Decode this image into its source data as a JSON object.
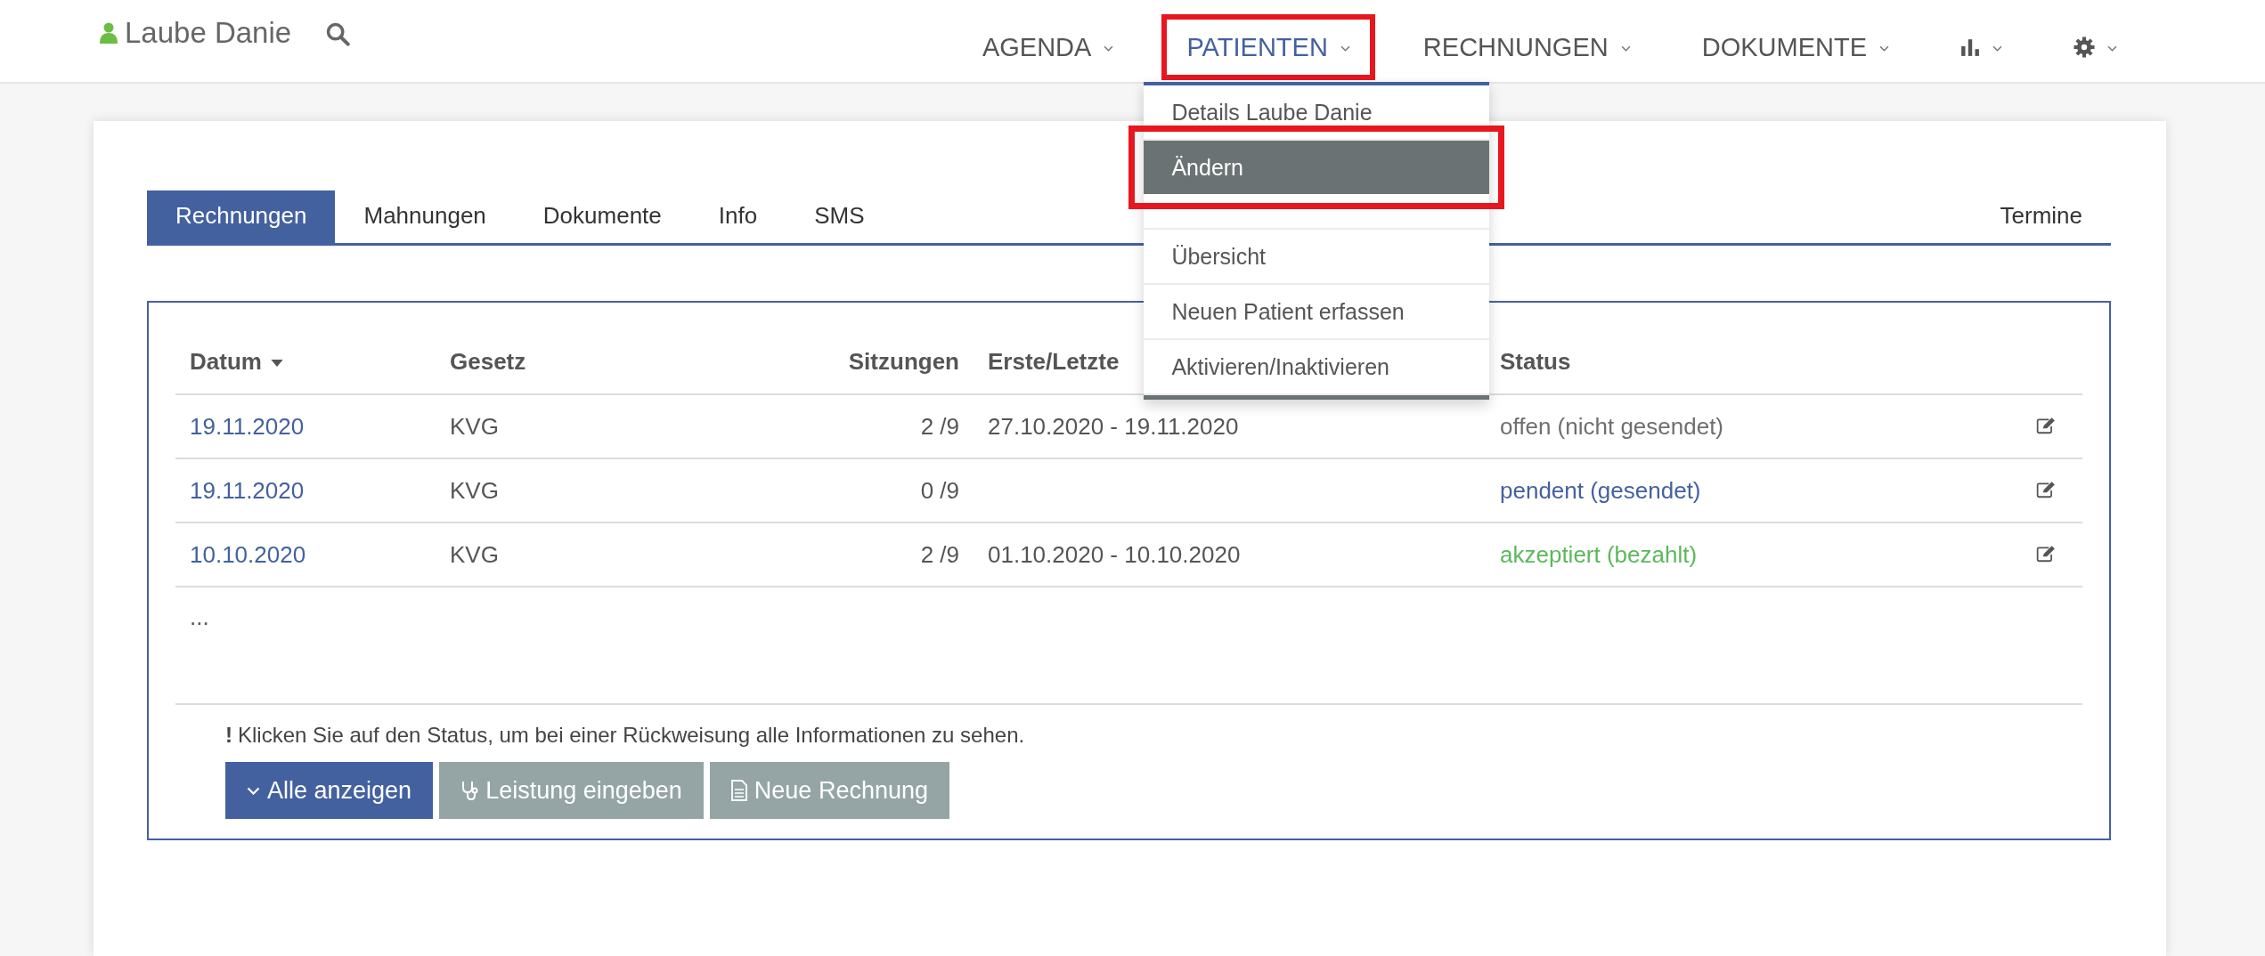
{
  "user": {
    "name": "Laube Danie"
  },
  "nav": [
    {
      "label": "AGENDA",
      "kind": "text",
      "selected": false,
      "annotated": false
    },
    {
      "label": "PATIENTEN",
      "kind": "text",
      "selected": true,
      "annotated": true
    },
    {
      "label": "RECHNUNGEN",
      "kind": "text",
      "selected": false,
      "annotated": false
    },
    {
      "label": "DOKUMENTE",
      "kind": "text",
      "selected": false,
      "annotated": false
    },
    {
      "kind": "chart",
      "selected": false,
      "annotated": false
    },
    {
      "kind": "settings",
      "selected": false,
      "annotated": false
    }
  ],
  "dropdown": [
    {
      "label": "Details Laube Danie",
      "highlighted": false,
      "annotated": false,
      "divider_after": false
    },
    {
      "label": "Ändern",
      "highlighted": true,
      "annotated": true,
      "divider_after": true
    },
    {
      "label": "Übersicht",
      "highlighted": false,
      "annotated": false,
      "divider_after": false
    },
    {
      "label": "Neuen Patient erfassen",
      "highlighted": false,
      "annotated": false,
      "divider_after": false
    },
    {
      "label": "Aktivieren/Inaktivieren",
      "highlighted": false,
      "annotated": false,
      "divider_after": false
    }
  ],
  "tabs": [
    {
      "label": "Rechnungen",
      "selected": true
    },
    {
      "label": "Mahnungen",
      "selected": false
    },
    {
      "label": "Dokumente",
      "selected": false
    },
    {
      "label": "Info",
      "selected": false
    },
    {
      "label": "SMS",
      "selected": false
    }
  ],
  "tab_right": {
    "label": "Termine",
    "selected": false
  },
  "table": {
    "columns": [
      {
        "label": "Datum",
        "sorted": true
      },
      {
        "label": "Gesetz",
        "sorted": false
      },
      {
        "label": "Sitzungen",
        "sorted": false
      },
      {
        "label": "Erste/Letzte",
        "sorted": false
      },
      {
        "label": "Status",
        "sorted": false
      }
    ],
    "rows": [
      {
        "date": "19.11.2020",
        "law": "KVG",
        "sessions": "2 /9",
        "range": "27.10.2020 - 19.11.2020",
        "status": "offen (nicht gesendet)",
        "kind": "open"
      },
      {
        "date": "19.11.2020",
        "law": "KVG",
        "sessions": "0 /9",
        "status": "pendent (gesendet)",
        "kind": "pending"
      },
      {
        "date": "10.10.2020",
        "law": "KVG",
        "sessions": "2 /9",
        "range": "01.10.2020 - 10.10.2020",
        "status": "akzeptiert (bezahlt)",
        "kind": "accepted"
      }
    ],
    "more": "..."
  },
  "note": {
    "mark": "!",
    "text": "Klicken Sie auf den Status, um bei einer Rückweisung alle Informationen zu sehen."
  },
  "buttons": [
    {
      "label": "Alle anzeigen",
      "kind": "expand"
    },
    {
      "label": "Leistung eingeben",
      "kind": "service"
    },
    {
      "label": "Neue Rechnung",
      "kind": "invoice"
    }
  ]
}
